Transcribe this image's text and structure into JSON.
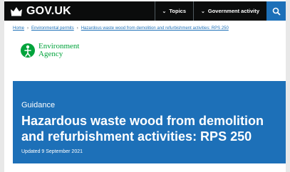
{
  "header": {
    "logo_text": "GOV.UK",
    "nav_topics": "Topics",
    "nav_government_activity": "Government activity",
    "search_icon": "search-icon"
  },
  "breadcrumb": {
    "items": [
      "Home",
      "Environmental permits",
      "Hazardous waste wood from demolition and refurbishment activities: RPS 250"
    ]
  },
  "organisation": {
    "name_line1": "Environment",
    "name_line2": "Agency",
    "color": "#00a33b"
  },
  "title_block": {
    "caption": "Guidance",
    "title": "Hazardous waste wood from demolition and refurbishment activities: RPS 250",
    "updated": "Updated 9 September 2021",
    "background": "#1d70b8"
  }
}
